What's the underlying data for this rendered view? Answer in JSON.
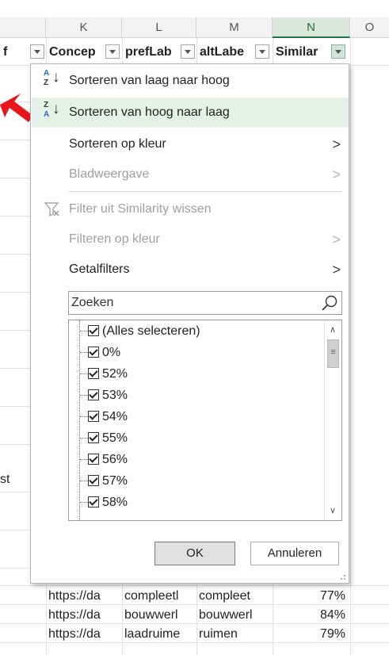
{
  "columns": [
    {
      "letter": "K"
    },
    {
      "letter": "L"
    },
    {
      "letter": "M"
    },
    {
      "letter": "N"
    },
    {
      "letter": "O"
    }
  ],
  "header_row": {
    "left_fragment": "f",
    "cells": [
      "Concep",
      "prefLab",
      "altLabe",
      "Similar"
    ],
    "active_filter_column": "Similar"
  },
  "left_fragment_row": "st",
  "data_rows": [
    {
      "concept": "https://da",
      "pref": "compleetl",
      "alt": "compleet",
      "similarity": "77%"
    },
    {
      "concept": "https://da",
      "pref": "bouwwerl",
      "alt": "bouwwerl",
      "similarity": "84%"
    },
    {
      "concept": "https://da",
      "pref": "laadruime",
      "alt": "ruimen",
      "similarity": "79%"
    }
  ],
  "menu": {
    "sort_asc": {
      "label": "Sorteren van laag naar hoog",
      "icon": "sort-ascending-icon"
    },
    "sort_desc": {
      "label": "Sorteren van hoog naar laag",
      "icon": "sort-descending-icon"
    },
    "sort_color": {
      "label": "Sorteren op kleur"
    },
    "sheet_view": {
      "label": "Bladweergave"
    },
    "clear_filter": {
      "label": "Filter uit Similarity wissen",
      "icon": "filter-clear-icon"
    },
    "filter_color": {
      "label": "Filteren op kleur"
    },
    "number_filters": {
      "label": "Getalfilters"
    }
  },
  "search": {
    "placeholder": "Zoeken",
    "icon": "magnifier-icon"
  },
  "filter_list": [
    {
      "label": "(Alles selecteren)",
      "checked": true
    },
    {
      "label": "0%",
      "checked": true
    },
    {
      "label": "52%",
      "checked": true
    },
    {
      "label": "53%",
      "checked": true
    },
    {
      "label": "54%",
      "checked": true
    },
    {
      "label": "55%",
      "checked": true
    },
    {
      "label": "56%",
      "checked": true
    },
    {
      "label": "57%",
      "checked": true
    },
    {
      "label": "58%",
      "checked": true
    }
  ],
  "buttons": {
    "ok": "OK",
    "cancel": "Annuleren"
  },
  "colors": {
    "accent_green": "#217346",
    "highlight": "#e5f1e8",
    "arrow_red": "#e8151b"
  }
}
